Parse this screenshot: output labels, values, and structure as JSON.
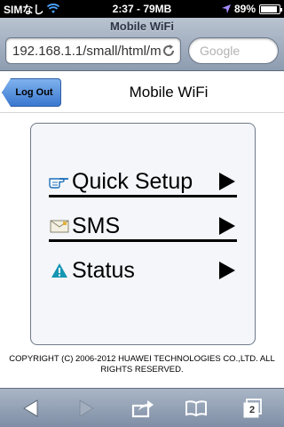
{
  "status_bar": {
    "carrier": "SIMなし",
    "time": "2:37 - 79MB",
    "battery": "89%",
    "battery_level": 0.89
  },
  "browser": {
    "page_title": "Mobile WiFi",
    "url": "192.168.1.1/small/html/m",
    "search_placeholder": "Google",
    "tab_count": "2"
  },
  "header": {
    "logout_label": "Log Out",
    "title": "Mobile WiFi"
  },
  "menu": {
    "items": [
      {
        "label": "Quick Setup",
        "icon": "pointing-hand-icon"
      },
      {
        "label": "SMS",
        "icon": "envelope-icon"
      },
      {
        "label": "Status",
        "icon": "warning-icon"
      }
    ]
  },
  "footer": {
    "copyright": "COPYRIGHT (C) 2006-2012 HUAWEI TECHNOLOGIES CO.,LTD. ALL RIGHTS RESERVED."
  },
  "colors": {
    "accent": "#3a78d0",
    "toolbar": "#8e9cb0"
  }
}
